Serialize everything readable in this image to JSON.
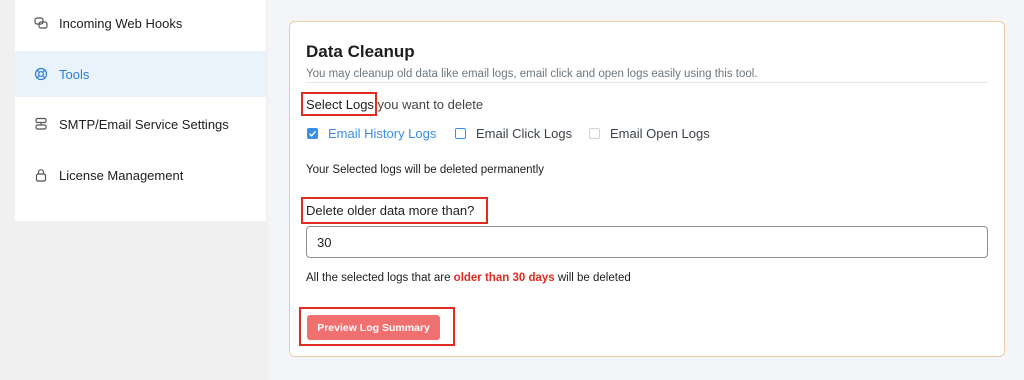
{
  "sidebar": {
    "items": [
      {
        "label": "Incoming Web Hooks",
        "icon": "webhook-icon",
        "active": false
      },
      {
        "label": "Tools",
        "icon": "lifebuoy-icon",
        "active": true
      },
      {
        "label": "SMTP/Email Service Settings",
        "icon": "server-icon",
        "active": false
      },
      {
        "label": "License Management",
        "icon": "lock-icon",
        "active": false
      }
    ]
  },
  "panel": {
    "title": "Data Cleanup",
    "subtitle": "You may cleanup old data like email logs, email click and open logs easily using this tool.",
    "select_heading_highlight": "Select Logs",
    "select_heading_rest": " you want to delete",
    "checkboxes": [
      {
        "label": "Email History Logs",
        "checked": true
      },
      {
        "label": "Email Click Logs",
        "checked": false
      },
      {
        "label": "Email Open Logs",
        "checked": false
      }
    ],
    "deleted_note": "Your Selected logs will be deleted permanently",
    "older_heading": "Delete older data more than?",
    "days_value": "30",
    "warning_prefix": "All the selected logs that are ",
    "warning_highlight": "older than 30 days",
    "warning_suffix": " will be deleted",
    "preview_button": "Preview Log Summary"
  },
  "colors": {
    "accent_blue": "#3b8ee6",
    "highlight_red": "#e02b20",
    "button_red": "#f07070",
    "card_border": "#f1c9a1"
  }
}
